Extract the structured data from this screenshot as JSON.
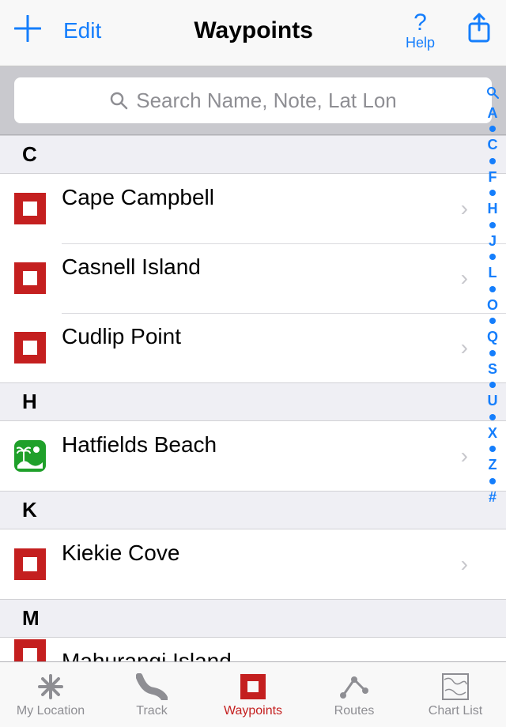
{
  "nav": {
    "edit": "Edit",
    "title": "Waypoints",
    "help_q": "?",
    "help_label": "Help"
  },
  "search": {
    "placeholder": "Search Name, Note, Lat Lon"
  },
  "sections": {
    "c": "C",
    "h": "H",
    "k": "K",
    "m": "M"
  },
  "rows": {
    "cape": "Cape Campbell",
    "casnell": "Casnell Island",
    "cudlip": "Cudlip Point",
    "hatfields": "Hatfields Beach",
    "kiekie": "Kiekie Cove",
    "mahurangi": "Mahurangi Island"
  },
  "index": [
    "A",
    "C",
    "F",
    "H",
    "J",
    "L",
    "O",
    "Q",
    "S",
    "U",
    "X",
    "Z",
    "#"
  ],
  "tabs": {
    "loc": "My Location",
    "track": "Track",
    "waypoints": "Waypoints",
    "routes": "Routes",
    "chart": "Chart List"
  }
}
